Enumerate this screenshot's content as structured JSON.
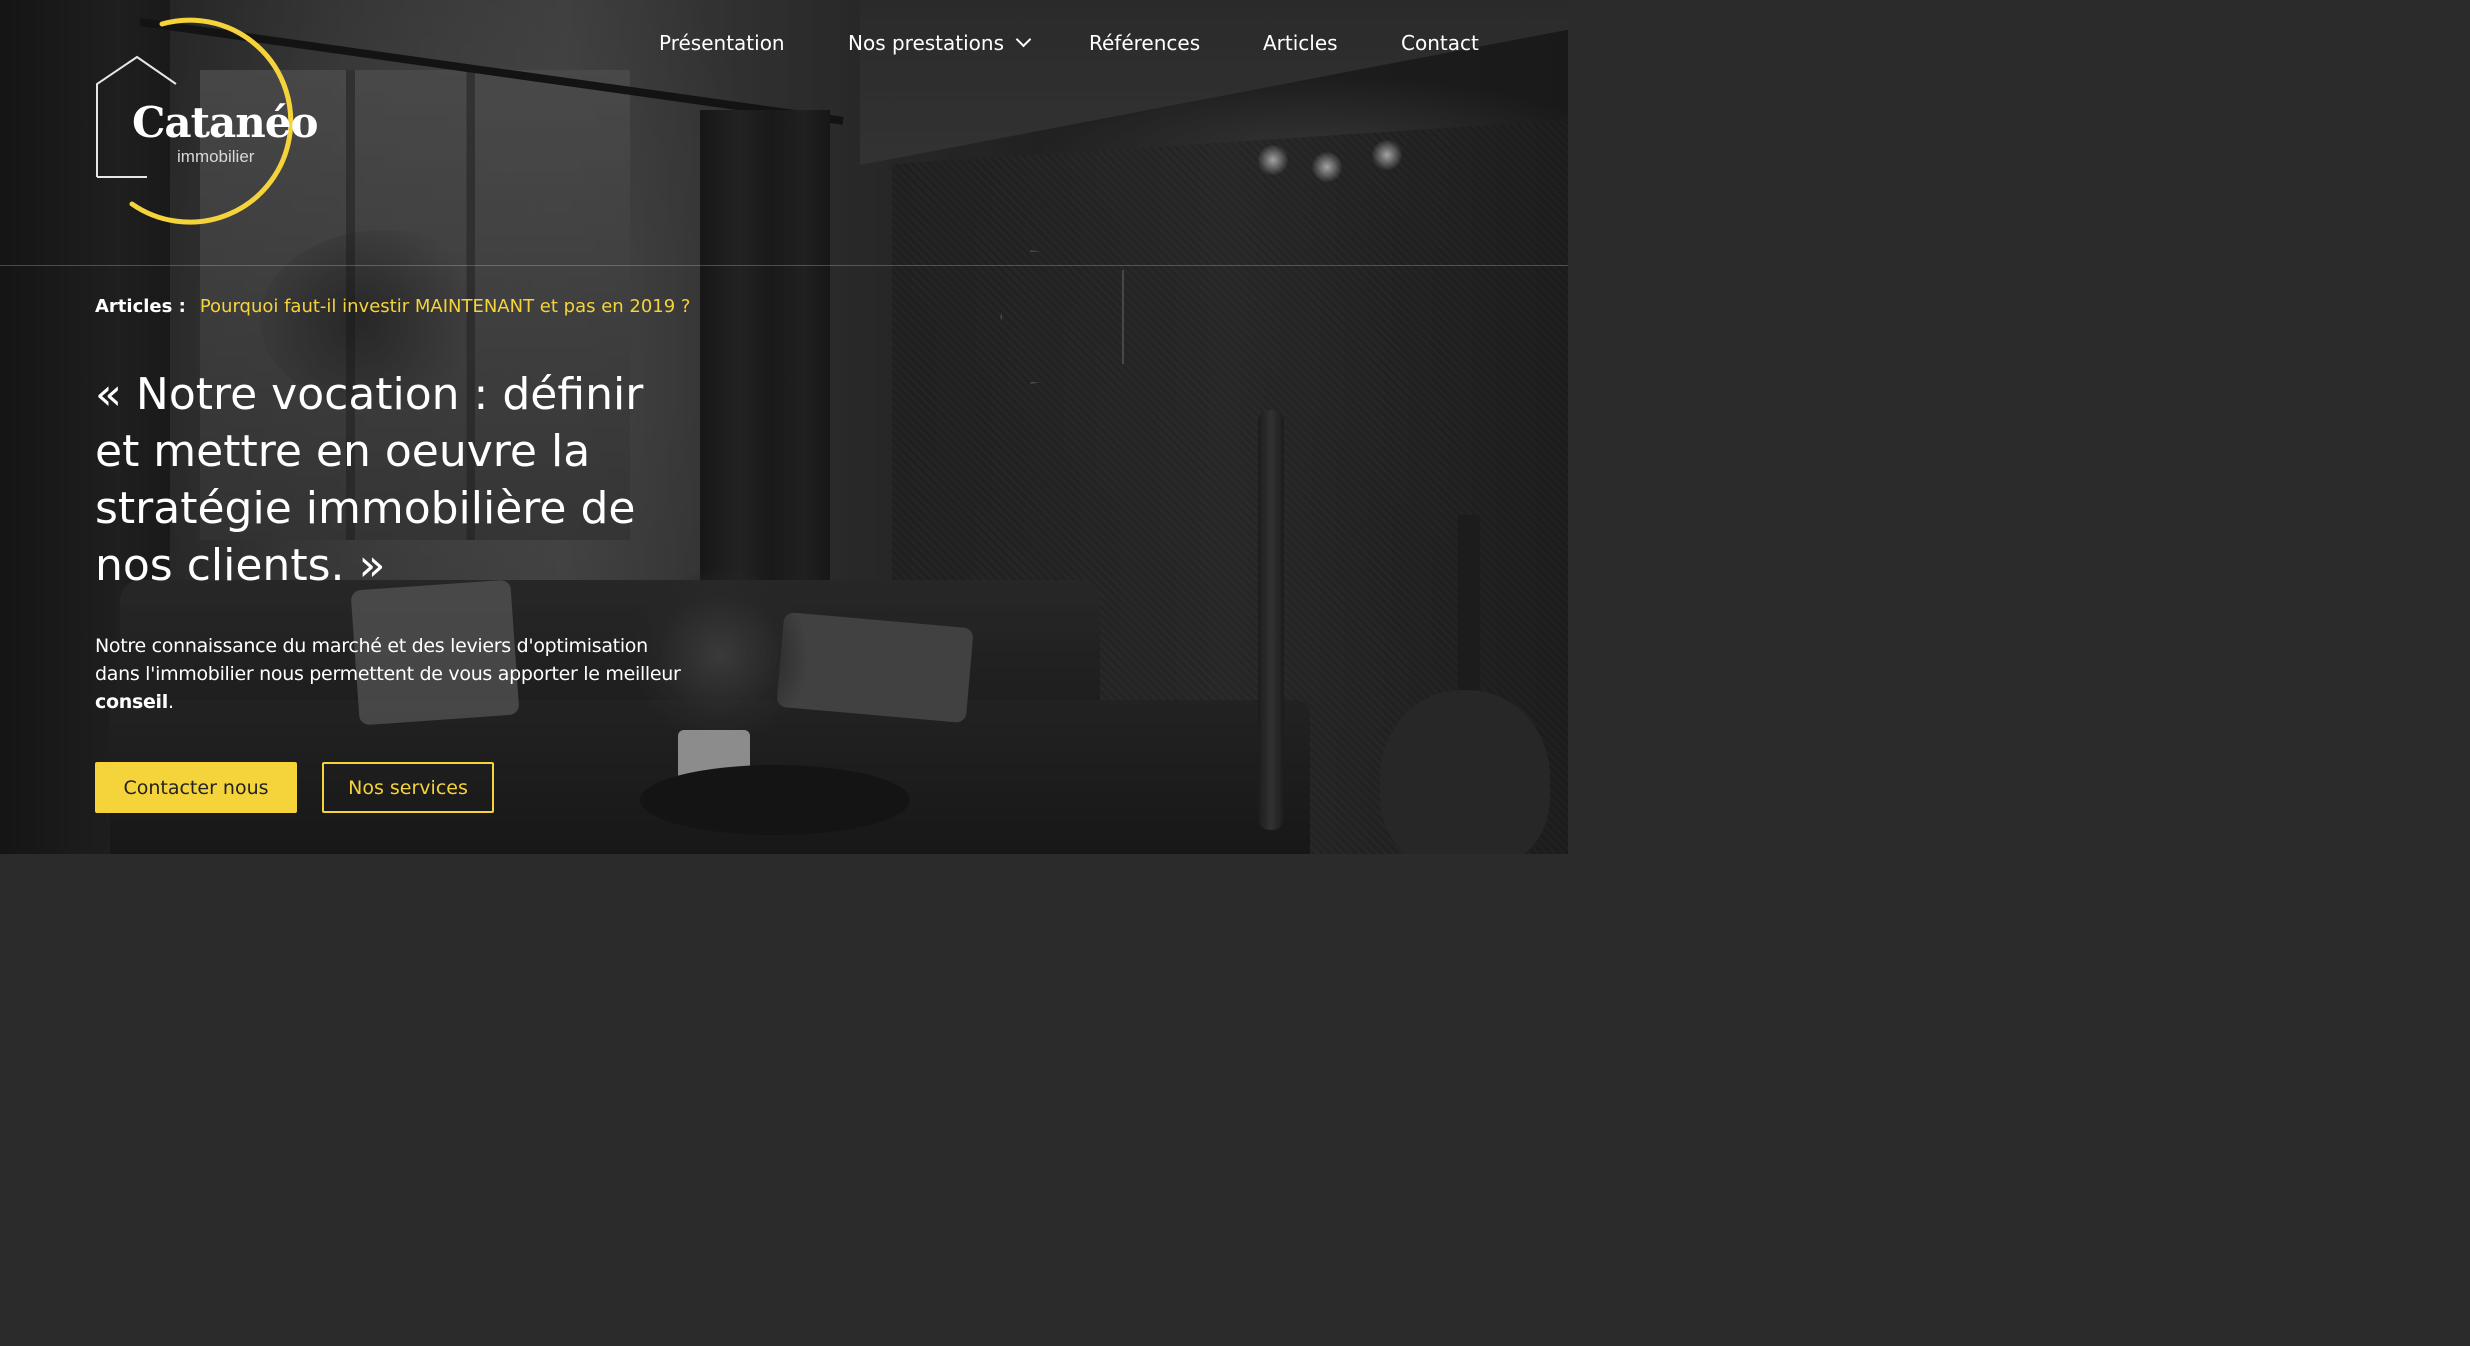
{
  "brand": {
    "name": "Catanéo",
    "subtitle": "immobilier",
    "accent_color": "#f5d33b"
  },
  "nav": {
    "items": [
      {
        "label": "Présentation"
      },
      {
        "label": "Nos prestations",
        "has_dropdown": true
      },
      {
        "label": "Références"
      },
      {
        "label": "Articles"
      },
      {
        "label": "Contact"
      }
    ]
  },
  "hero": {
    "article_label": "Articles :",
    "article_link": "Pourquoi faut-il investir MAINTENANT et pas en 2019 ?",
    "headline": "« Notre vocation : définir et mettre en oeuvre la stratégie immobilière de nos clients. »",
    "intro_text": "Notre connaissance du marché et des leviers d'optimisation dans l'immobilier nous permettent de vous apporter le meilleur ",
    "intro_bold": "conseil",
    "intro_end": ".",
    "primary_button": "Contacter nous",
    "secondary_button": "Nos services"
  }
}
